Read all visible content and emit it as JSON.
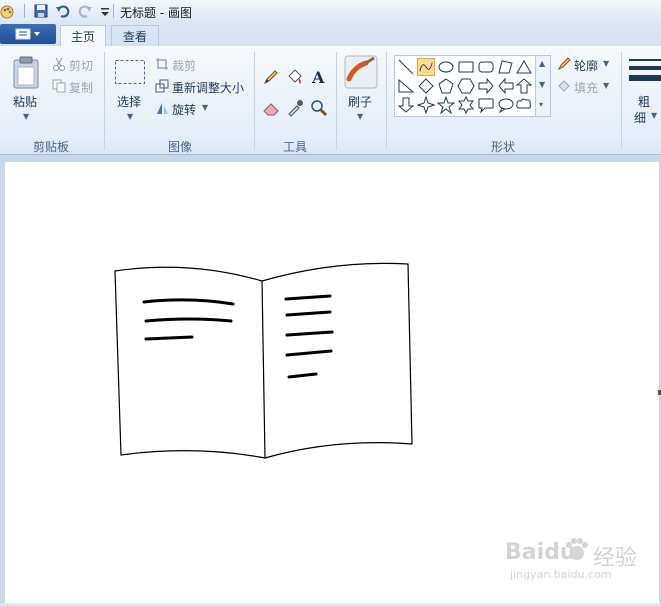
{
  "titlebar": {
    "title": "无标题 - 画图"
  },
  "tabs": {
    "file_icon": "app-menu-icon",
    "home": "主页",
    "view": "查看"
  },
  "clipboard": {
    "paste": "粘贴",
    "cut": "剪切",
    "copy": "复制",
    "group": "剪贴板"
  },
  "image": {
    "select": "选择",
    "crop": "裁剪",
    "resize": "重新调整大小",
    "rotate": "旋转",
    "group": "图像"
  },
  "tools": {
    "group": "工具"
  },
  "brushes": {
    "label": "刷子"
  },
  "shapes": {
    "outline": "轮廓",
    "fill": "填充",
    "group": "形状"
  },
  "size": {
    "label_line1": "粗",
    "label_line2": "细"
  },
  "watermark": {
    "brand": "Baidu",
    "suffix": "经验",
    "url": "jingyan.baidu.com"
  }
}
